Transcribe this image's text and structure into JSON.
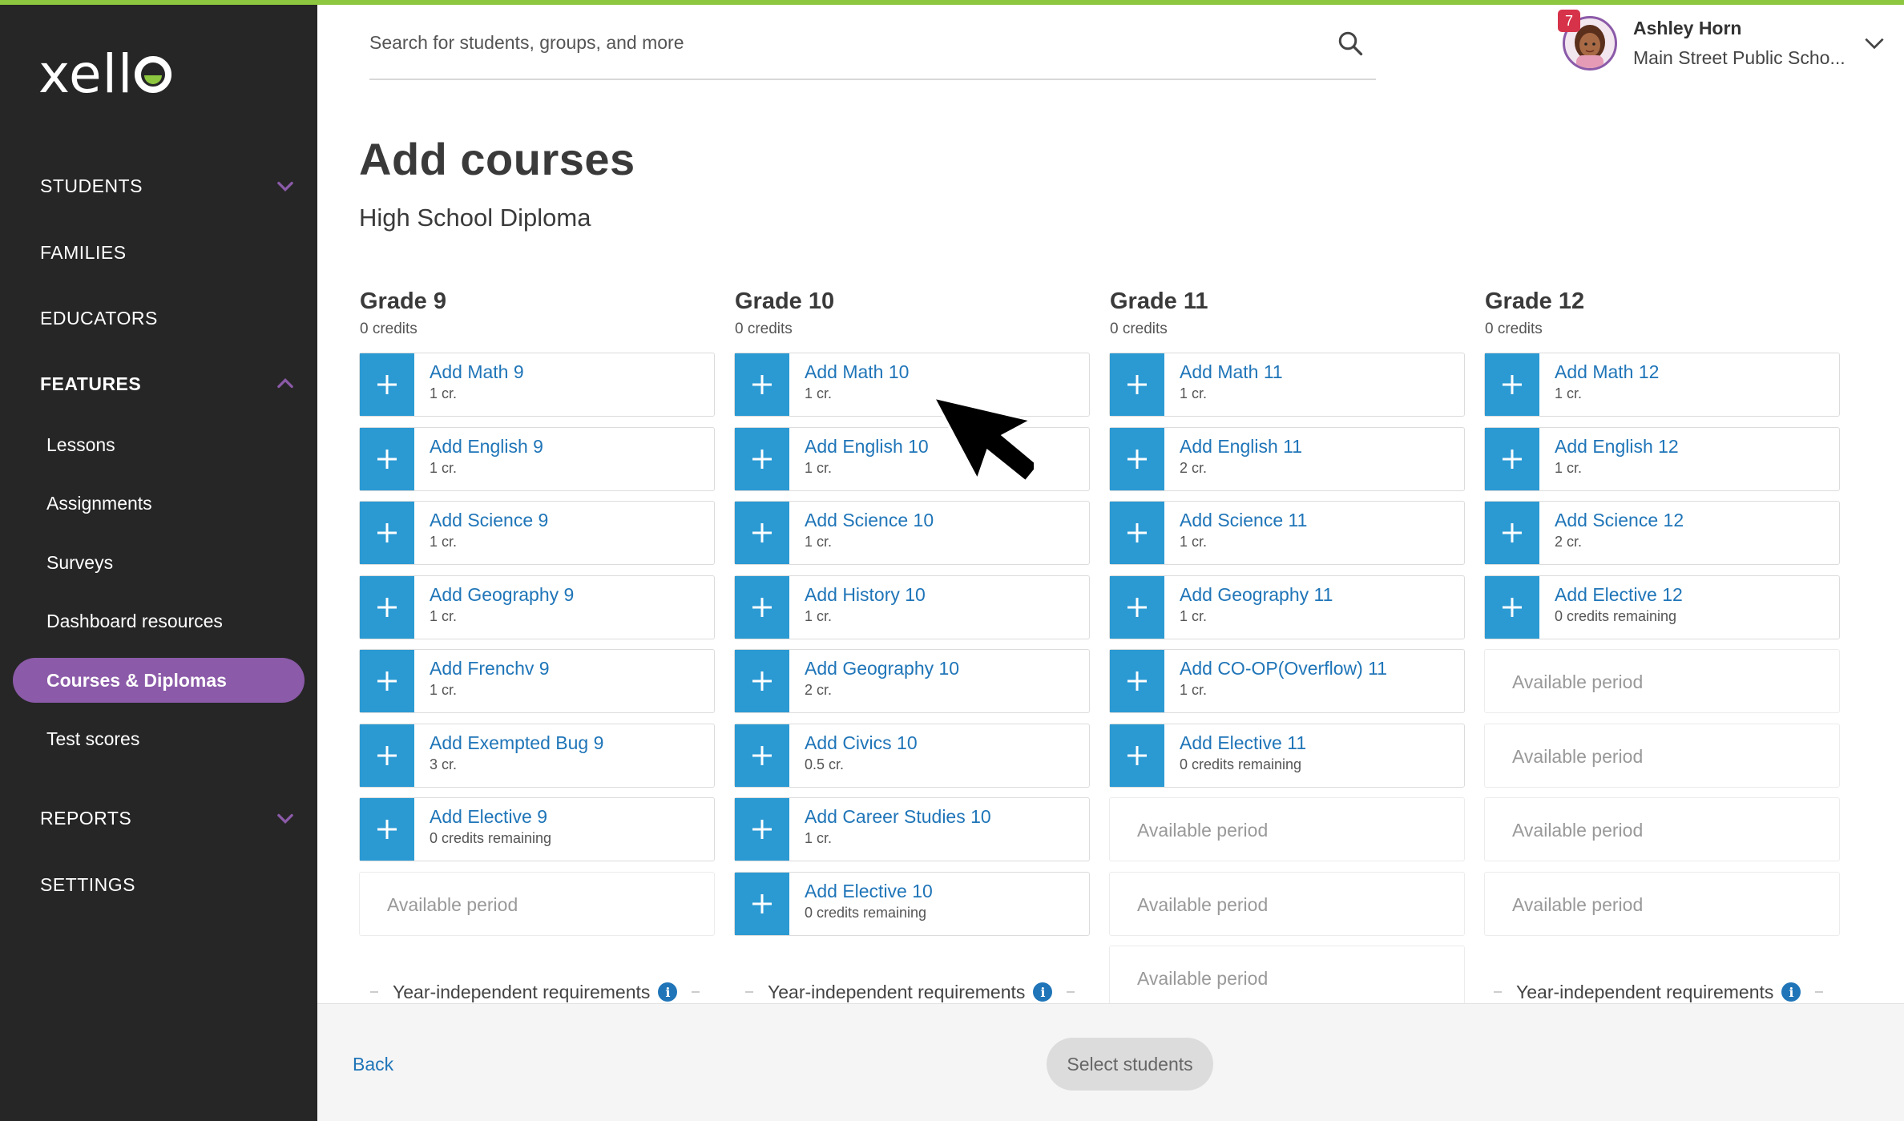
{
  "app": {
    "logo_text": "xell",
    "accent_color": "#8b5aa8",
    "link_color": "#1f75b8",
    "plus_color": "#2b9ad3",
    "brand_green": "#8dc63f"
  },
  "sidebar": {
    "students": "STUDENTS",
    "families": "FAMILIES",
    "educators": "EDUCATORS",
    "features": "FEATURES",
    "features_items": {
      "lessons": "Lessons",
      "assignments": "Assignments",
      "surveys": "Surveys",
      "dashboard": "Dashboard resources",
      "courses": "Courses & Diplomas",
      "test_scores": "Test scores"
    },
    "reports": "REPORTS",
    "settings": "SETTINGS"
  },
  "header": {
    "search_placeholder": "Search for students, groups, and more",
    "notification_count": "7",
    "user_name": "Ashley Horn",
    "user_school": "Main Street Public Scho..."
  },
  "main": {
    "title": "Add courses",
    "subtitle": "High School Diploma",
    "empty_label": "Available period",
    "year_independent_label": "Year-independent requirements",
    "grades": [
      {
        "title": "Grade 9",
        "credits": "0 credits",
        "courses": [
          {
            "name": "Add Math 9",
            "credit": "1 cr."
          },
          {
            "name": "Add English 9",
            "credit": "1 cr."
          },
          {
            "name": "Add Science 9",
            "credit": "1 cr."
          },
          {
            "name": "Add Geography 9",
            "credit": "1 cr."
          },
          {
            "name": "Add Frenchv 9",
            "credit": "1 cr."
          },
          {
            "name": "Add Exempted Bug 9",
            "credit": "3 cr."
          },
          {
            "name": "Add Elective 9",
            "credit": "0 credits remaining"
          }
        ]
      },
      {
        "title": "Grade 10",
        "credits": "0 credits",
        "courses": [
          {
            "name": "Add Math 10",
            "credit": "1 cr."
          },
          {
            "name": "Add English 10",
            "credit": "1 cr."
          },
          {
            "name": "Add Science 10",
            "credit": "1 cr."
          },
          {
            "name": "Add History 10",
            "credit": "1 cr."
          },
          {
            "name": "Add Geography 10",
            "credit": "2 cr."
          },
          {
            "name": "Add Civics 10",
            "credit": "0.5 cr."
          },
          {
            "name": "Add Career Studies 10",
            "credit": "1 cr."
          },
          {
            "name": "Add Elective 10",
            "credit": "0 credits remaining"
          }
        ]
      },
      {
        "title": "Grade 11",
        "credits": "0 credits",
        "courses": [
          {
            "name": "Add Math 11",
            "credit": "1 cr."
          },
          {
            "name": "Add English 11",
            "credit": "2 cr."
          },
          {
            "name": "Add Science 11",
            "credit": "1 cr."
          },
          {
            "name": "Add Geography 11",
            "credit": "1 cr."
          },
          {
            "name": "Add CO-OP(Overflow) 11",
            "credit": "1 cr."
          },
          {
            "name": "Add Elective 11",
            "credit": "0 credits remaining"
          }
        ]
      },
      {
        "title": "Grade 12",
        "credits": "0 credits",
        "courses": [
          {
            "name": "Add Math 12",
            "credit": "1 cr."
          },
          {
            "name": "Add English 12",
            "credit": "1 cr."
          },
          {
            "name": "Add Science 12",
            "credit": "2 cr."
          },
          {
            "name": "Add Elective 12",
            "credit": "0 credits remaining"
          }
        ]
      }
    ]
  },
  "footer": {
    "back_label": "Back",
    "select_label": "Select students"
  }
}
